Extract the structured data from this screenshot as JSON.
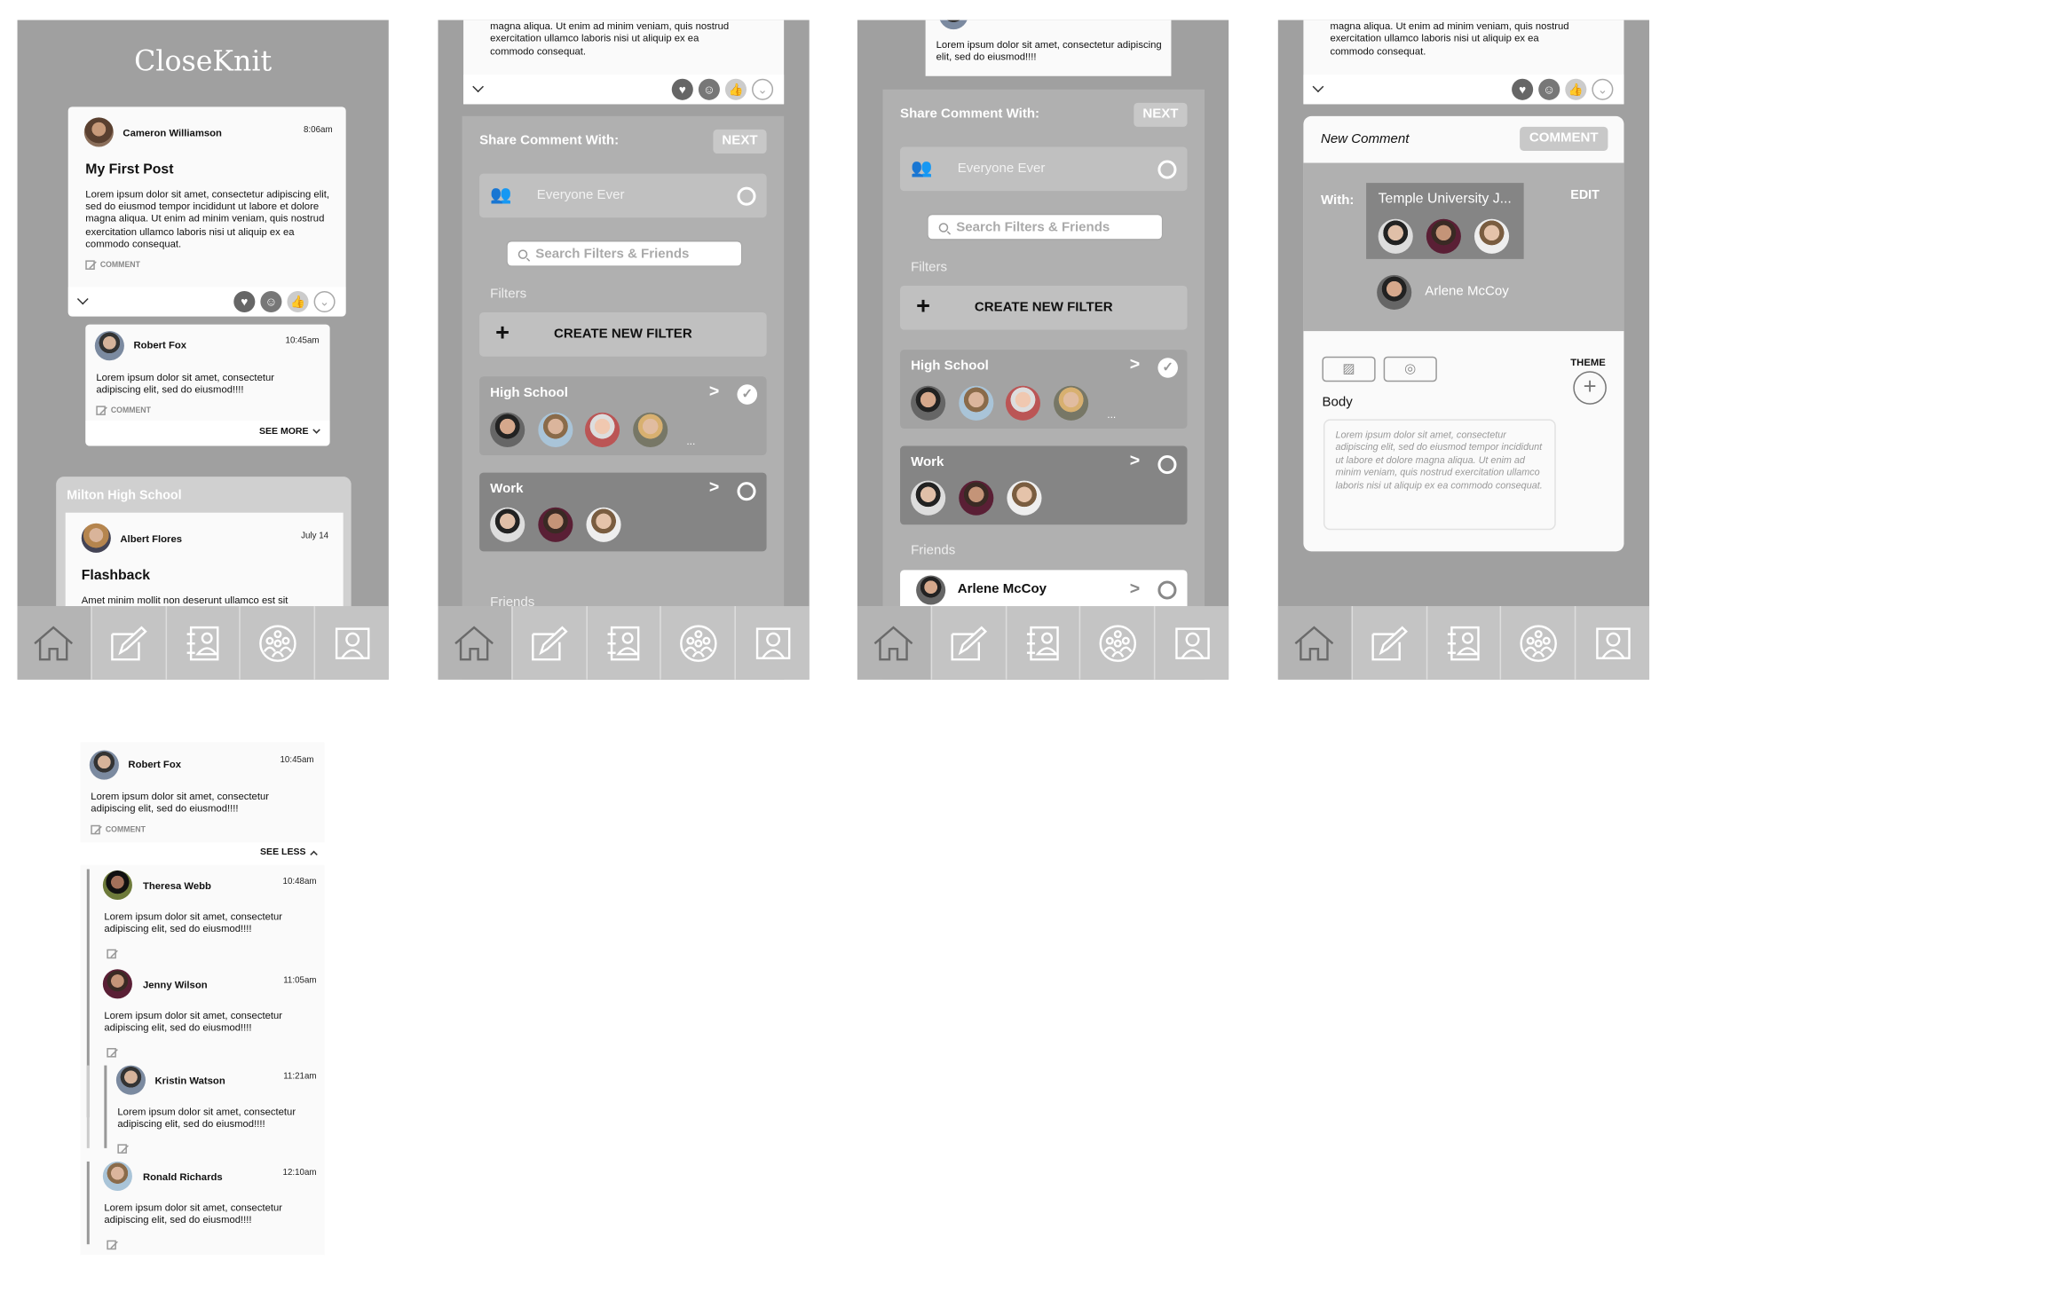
{
  "app": {
    "title": "CloseKnit"
  },
  "lorem_short": "Lorem ipsum dolor sit amet, consectetur adipiscing elit, sed do eiusmod!!!!",
  "lorem_long_tail": [
    "magna aliqua. Ut enim ad minim veniam, quis nostrud",
    "exercitation ullamco laboris nisi ut aliquip ex ea",
    "commodo consequat."
  ],
  "feed": {
    "post": {
      "author": "Cameron Williamson",
      "time": "8:06am",
      "title": "My First Post",
      "body": "Lorem ipsum dolor sit amet, consectetur adipiscing elit, sed do eiusmod tempor incididunt ut labore et dolore magna aliqua. Ut enim ad minim veniam, quis nostrud exercitation ullamco laboris nisi ut aliquip ex ea commodo consequat.",
      "comment_label": "COMMENT"
    },
    "reply": {
      "author": "Robert Fox",
      "time": "10:45am",
      "comment_label": "COMMENT",
      "see_more": "SEE MORE"
    },
    "group": {
      "name": "Milton High School",
      "author": "Albert Flores",
      "time": "July 14",
      "title": "Flashback",
      "body": "Amet minim mollit non deserunt ullamco est sit"
    },
    "reactions": [
      "heart-icon",
      "smile-icon",
      "thumbs-up-icon",
      "thumbs-down-icon"
    ]
  },
  "share": {
    "title": "Share Comment With:",
    "next": "NEXT",
    "everyone": "Everyone Ever",
    "search_placeholder": "Search Filters & Friends",
    "filters_label": "Filters",
    "create_filter": "CREATE NEW FILTER",
    "filters": [
      {
        "name": "High School",
        "selected": true,
        "more": "..."
      },
      {
        "name": "Work",
        "selected": false
      }
    ],
    "friends_label": "Friends",
    "friends": [
      {
        "name": "Arlene McCoy",
        "selected": false
      }
    ]
  },
  "new_comment": {
    "title": "New Comment",
    "submit": "COMMENT",
    "with_label": "With:",
    "group": "Temple University J...",
    "edit": "EDIT",
    "friend": "Arlene McCoy",
    "theme": "THEME",
    "body_label": "Body",
    "body_placeholder": "Lorem ipsum dolor sit amet, consectetur adipiscing elit, sed do eiusmod tempor incididunt ut labore et dolore magna aliqua. Ut enim ad minim veniam, quis nostrud exercitation ullamco laboris nisi ut aliquip ex ea commodo consequat."
  },
  "thread": {
    "root": {
      "author": "Robert Fox",
      "time": "10:45am",
      "comment_label": "COMMENT"
    },
    "see_less": "SEE LESS",
    "replies": [
      {
        "author": "Theresa Webb",
        "time": "10:48am"
      },
      {
        "author": "Jenny Wilson",
        "time": "11:05am"
      },
      {
        "author": "Kristin Watson",
        "time": "11:21am"
      },
      {
        "author": "Ronald Richards",
        "time": "12:10am"
      }
    ]
  },
  "nav": [
    "home-icon",
    "compose-icon",
    "contacts-icon",
    "groups-icon",
    "profile-icon"
  ],
  "colors": {
    "phone_bg": "#a0a0a0",
    "panel": "#b0b0b0",
    "nav": "#c4c4c4",
    "card": "#fafafa",
    "selected_filter": "#858585"
  }
}
